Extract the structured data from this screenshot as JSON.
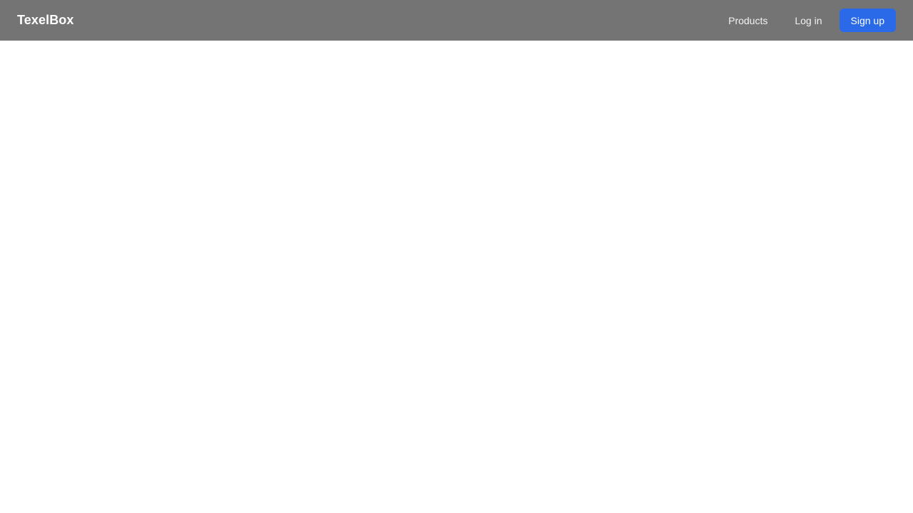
{
  "header": {
    "brand": "TexelBox",
    "nav": {
      "products_label": "Products",
      "login_label": "Log in",
      "signup_label": "Sign up"
    }
  },
  "colors": {
    "header_background": "#747474",
    "accent": "#2a6ae9",
    "page_background": "#ffffff"
  }
}
